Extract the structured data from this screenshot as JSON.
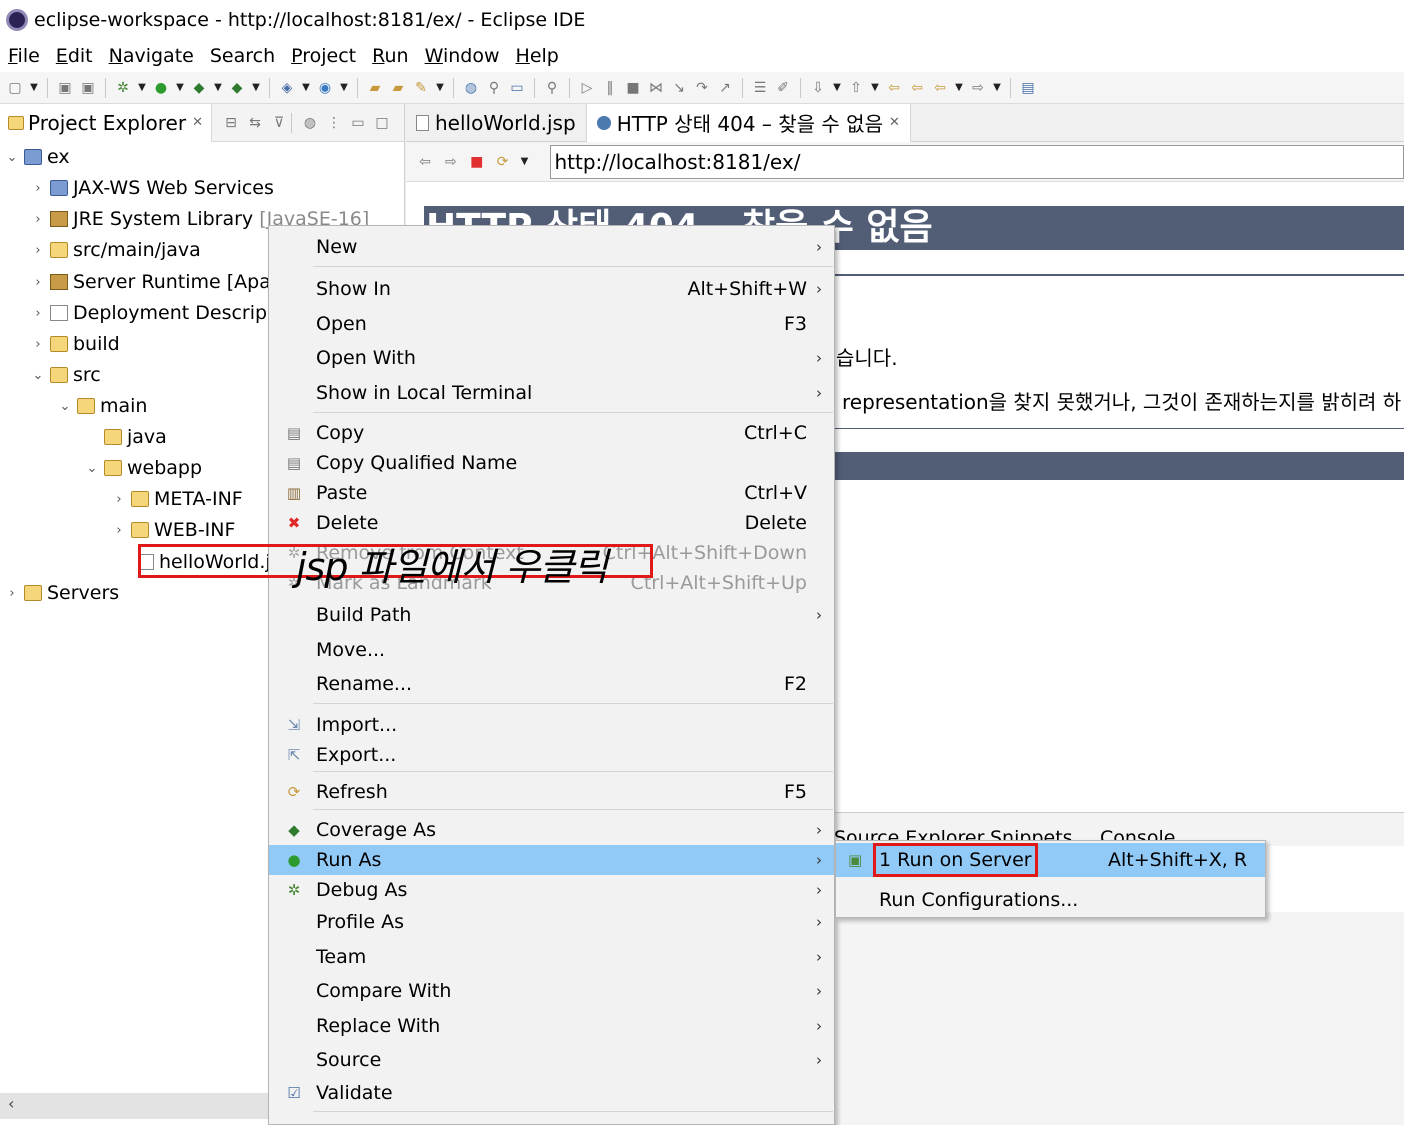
{
  "window": {
    "title": "eclipse-workspace - http://localhost:8181/ex/ - Eclipse IDE"
  },
  "menubar": [
    {
      "label": "File",
      "mnemonic": "F",
      "rest": "ile"
    },
    {
      "label": "Edit",
      "mnemonic": "E",
      "rest": "dit"
    },
    {
      "label": "Navigate",
      "mnemonic": "N",
      "rest": "avigate"
    },
    {
      "label": "Search",
      "mnemonic": "",
      "rest": "Search"
    },
    {
      "label": "Project",
      "mnemonic": "P",
      "rest": "roject"
    },
    {
      "label": "Run",
      "mnemonic": "R",
      "rest": "un"
    },
    {
      "label": "Window",
      "mnemonic": "W",
      "rest": "indow"
    },
    {
      "label": "Help",
      "mnemonic": "H",
      "rest": "elp"
    }
  ],
  "explorer": {
    "tab_label": "Project Explorer",
    "tree": {
      "ex": "ex",
      "jaxws": "JAX-WS Web Services",
      "jre": "JRE System Library",
      "jre_version": "[JavaSE-16]",
      "srcmainjava": "src/main/java",
      "server_runtime": "Server Runtime [Apa",
      "deployment": "Deployment Descrip",
      "build": "build",
      "src": "src",
      "main": "main",
      "java": "java",
      "webapp": "webapp",
      "metainf": "META-INF",
      "webinf": "WEB-INF",
      "helloworld": "helloWorld.j",
      "servers": "Servers"
    }
  },
  "editor": {
    "tabs": [
      {
        "label": "helloWorld.jsp"
      },
      {
        "label": "HTTP 상태 404 – 찾을 수 없음"
      }
    ],
    "url": "http://localhost:8181/ex/",
    "page": {
      "heading": "HTTP 상태 404 – 찾을 수 없음",
      "line1": "습니다.",
      "line2": "representation을 찾지 못했거나, 그것이 존재하는지를 밝히려 하"
    },
    "bottom_tabs": [
      "Source Explorer",
      "Snippets",
      "Console"
    ]
  },
  "context_menu": {
    "new": "New",
    "show_in": "Show In",
    "show_in_sc": "Alt+Shift+W",
    "open": "Open",
    "open_sc": "F3",
    "open_with": "Open With",
    "show_local_terminal": "Show in Local Terminal",
    "copy": "Copy",
    "copy_sc": "Ctrl+C",
    "copy_qualified": "Copy Qualified Name",
    "paste": "Paste",
    "paste_sc": "Ctrl+V",
    "delete": "Delete",
    "delete_sc": "Delete",
    "remove_context": "Remove from Context",
    "remove_context_sc": "Ctrl+Alt+Shift+Down",
    "mark_landmark": "Mark as Landmark",
    "mark_landmark_sc": "Ctrl+Alt+Shift+Up",
    "build_path": "Build Path",
    "move": "Move...",
    "rename": "Rename...",
    "rename_sc": "F2",
    "import": "Import...",
    "export": "Export...",
    "refresh": "Refresh",
    "refresh_sc": "F5",
    "coverage_as": "Coverage As",
    "run_as": "Run As",
    "debug_as": "Debug As",
    "profile_as": "Profile As",
    "team": "Team",
    "compare_with": "Compare With",
    "replace_with": "Replace With",
    "source": "Source",
    "validate": "Validate"
  },
  "submenu": {
    "run_on_server": "1 Run on Server",
    "run_on_server_sc": "Alt+Shift+X, R",
    "run_configurations": "Run Configurations..."
  },
  "annotation": {
    "text": "jsp 파일에서 우클릭"
  }
}
